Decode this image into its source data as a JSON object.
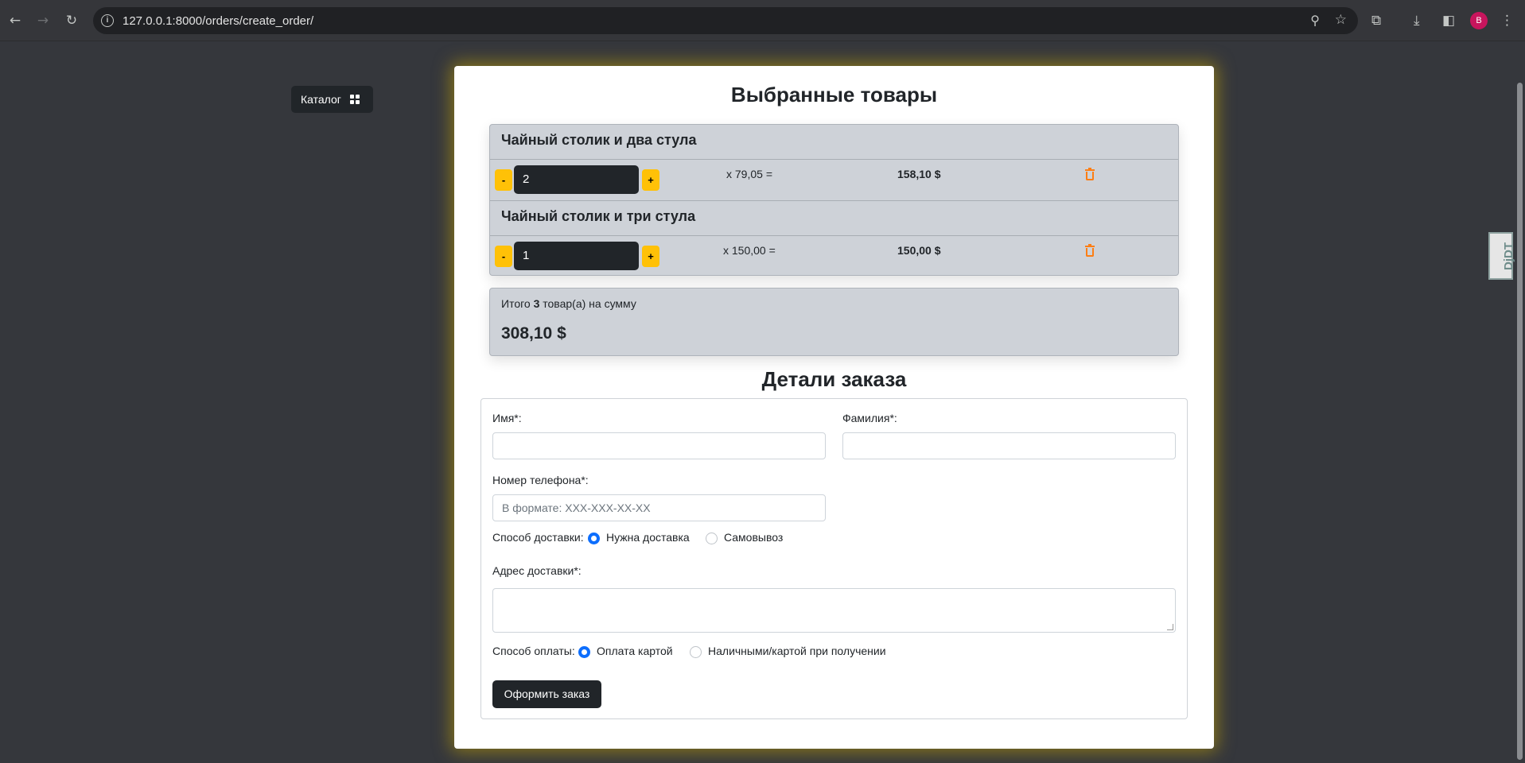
{
  "browser": {
    "url": "127.0.0.1:8000/orders/create_order/",
    "profile_initial": "B",
    "back": "←",
    "forward": "→",
    "reload": "↻",
    "zoom_icon": "⚲",
    "star_icon": "☆",
    "extensions_icon": "⧉",
    "download_icon": "⤓",
    "sidepanel_icon": "◧",
    "menu_icon": "⋮"
  },
  "djdt": {
    "label": "DjDT"
  },
  "catalog": {
    "label": "Каталог"
  },
  "cart": {
    "title": "Выбранные товары",
    "items": [
      {
        "name": "Чайный столик и два стула",
        "quantity": "2",
        "unit_price": "x 79,05 =",
        "line_total": "158,10 $"
      },
      {
        "name": "Чайный столик и три стула",
        "quantity": "1",
        "unit_price": "x 150,00 =",
        "line_total": "150,00 $"
      }
    ],
    "minus_label": "-",
    "plus_label": "+",
    "summary_prefix": "Итого ",
    "summary_count": "3",
    "summary_suffix": " товар(а) на сумму",
    "total": "308,10 $"
  },
  "order": {
    "title": "Детали заказа",
    "first_name_label": "Имя*:",
    "last_name_label": "Фамилия*:",
    "phone_label": "Номер телефона*:",
    "phone_placeholder": "В формате: XXX-XXX-XX-XX",
    "delivery_label": "Способ доставки:",
    "delivery_options": [
      "Нужна доставка",
      "Самовывоз"
    ],
    "delivery_selected": "Нужна доставка",
    "address_label": "Адрес доставки*:",
    "payment_label": "Способ оплаты:",
    "payment_options": [
      "Оплата картой",
      "Наличными/картой при получении"
    ],
    "payment_selected": "Оплата картой",
    "submit_label": "Оформить заказ"
  },
  "colors": {
    "accent_yellow": "#ffc107",
    "trash_orange": "#fd7e14",
    "radio_blue": "#0d6efd",
    "dark_button": "#212529"
  }
}
